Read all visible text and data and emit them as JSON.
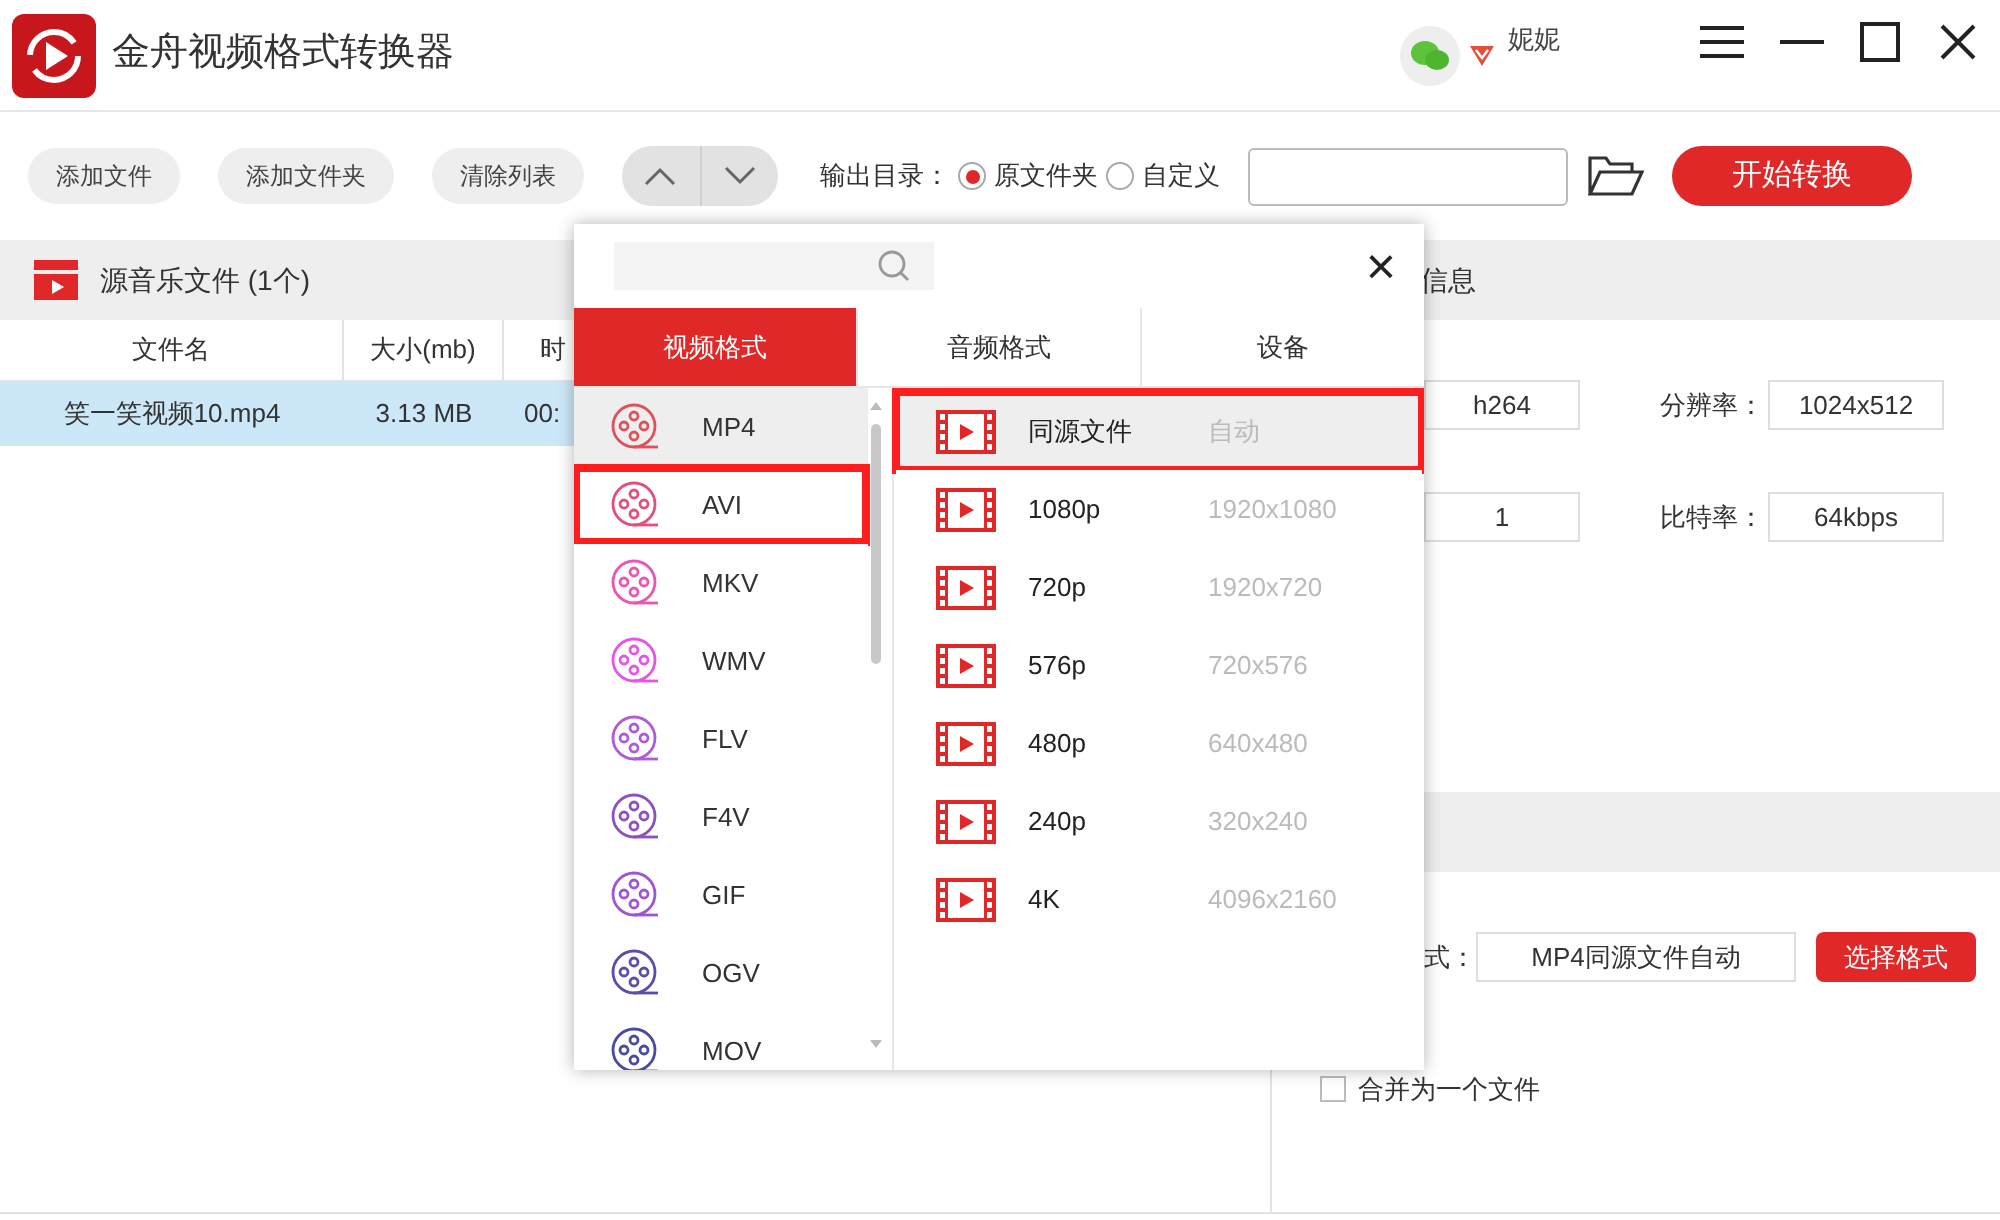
{
  "app": {
    "title": "金舟视频格式转换器",
    "user": "妮妮"
  },
  "toolbar": {
    "buttons": [
      "添加文件",
      "添加文件夹",
      "清除列表"
    ],
    "output_label": "输出目录：",
    "radios": [
      {
        "label": "原文件夹",
        "selected": true
      },
      {
        "label": "自定义",
        "selected": false
      }
    ],
    "start_button": "开始转换"
  },
  "source_panel": {
    "title": "源音乐文件 (1个)",
    "columns": [
      "文件名",
      "大小(mb)",
      "时"
    ],
    "rows": [
      {
        "cells": [
          "笑一笑视频10.mp4",
          "3.13 MB",
          "00:"
        ],
        "selected": true
      }
    ]
  },
  "settings_panel": {
    "title": "信息",
    "rows": [
      {
        "value": "h264",
        "label": "分辨率：",
        "value_2": "1024x512"
      },
      {
        "value": "1",
        "label": "比特率：",
        "value_2": "64kbps"
      }
    ],
    "format_label": "式：",
    "format_value": "MP4同源文件自动",
    "format_button": "选择格式",
    "merge": {
      "label": "合并为一个文件",
      "checked": false
    }
  },
  "format_popup": {
    "close": "×",
    "tabs": [
      {
        "label": "视频格式",
        "selected": true
      },
      {
        "label": "音频格式",
        "selected": false
      },
      {
        "label": "设备",
        "selected": false
      }
    ],
    "formats": [
      {
        "name": "MP4",
        "color": "#e0505a",
        "selected": true,
        "marked": false
      },
      {
        "name": "AVI",
        "color": "#e0507a",
        "selected": false,
        "marked": true
      },
      {
        "name": "MKV",
        "color": "#e855b5",
        "selected": false,
        "marked": false
      },
      {
        "name": "WMV",
        "color": "#e655e6",
        "selected": false,
        "marked": false
      },
      {
        "name": "FLV",
        "color": "#b05ad8",
        "selected": false,
        "marked": false
      },
      {
        "name": "F4V",
        "color": "#8e4fc0",
        "selected": false,
        "marked": false
      },
      {
        "name": "GIF",
        "color": "#a055d0",
        "selected": false,
        "marked": false
      },
      {
        "name": "OGV",
        "color": "#5a4fa8",
        "selected": false,
        "marked": false
      },
      {
        "name": "MOV",
        "color": "#4a4aa0",
        "selected": false,
        "marked": false
      }
    ],
    "presets": [
      {
        "name": "同源文件",
        "resolution": "自动",
        "selected": true,
        "marked": true
      },
      {
        "name": "1080p",
        "resolution": "1920x1080",
        "selected": false,
        "marked": false
      },
      {
        "name": "720p",
        "resolution": "1920x720",
        "selected": false,
        "marked": false
      },
      {
        "name": "576p",
        "resolution": "720x576",
        "selected": false,
        "marked": false
      },
      {
        "name": "480p",
        "resolution": "640x480",
        "selected": false,
        "marked": false
      },
      {
        "name": "240p",
        "resolution": "320x240",
        "selected": false,
        "marked": false
      },
      {
        "name": "4K",
        "resolution": "4096x2160",
        "selected": false,
        "marked": false
      }
    ]
  }
}
